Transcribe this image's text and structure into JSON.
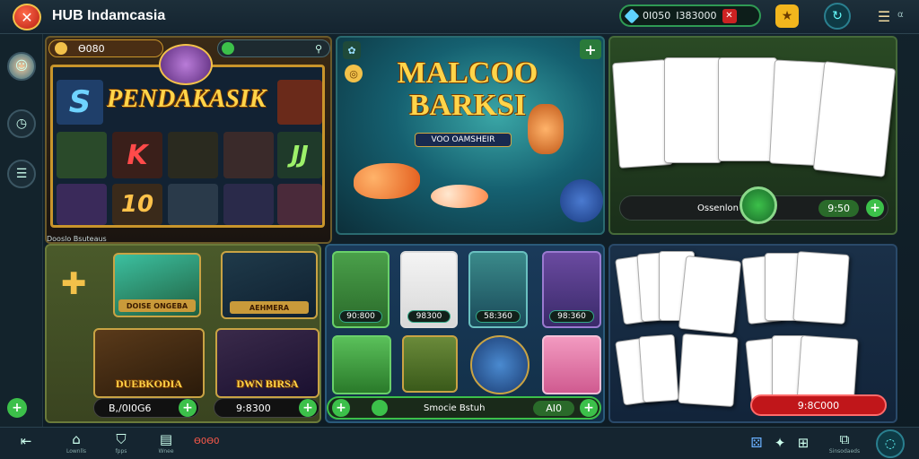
{
  "app": {
    "title": "HUB Indamcasia",
    "logo_glyph": "✕"
  },
  "topbar": {
    "wallet_a": "0I050",
    "wallet_b": "I383000",
    "icons": [
      "treasure-icon",
      "refresh-icon",
      "menu-icon"
    ],
    "corner_text": "α"
  },
  "sidebar": {
    "items": [
      "avatar",
      "history-icon",
      "list-icon"
    ]
  },
  "slot_panel": {
    "left_pill": "Ɵ080",
    "right_pill": "",
    "banner": "PENDAKASIK",
    "tiles": [
      "S",
      "K",
      "JJ",
      "10"
    ],
    "caption": "Dooslo Bsuteaus"
  },
  "fish_panel": {
    "title_line1": "MALCOO",
    "title_line2": "BARKSI",
    "badge": "VOO OAMSHEIR"
  },
  "cards_panel": {
    "label": "Ossenlon",
    "amount": "9:50"
  },
  "promo_panel": {
    "tiles": [
      {
        "label": "DOISE ONGEBA"
      },
      {
        "label": "AEHMERA"
      },
      {
        "label": "DUEBKODIA"
      },
      {
        "label": "DWN BIRSA"
      }
    ],
    "amount_left": "B,/0I0G6",
    "amount_right": "9:8300"
  },
  "fish_tiles_panel": {
    "prices": [
      "90:800",
      "98300",
      "58:360",
      "98:360"
    ],
    "bottom_label": "Smocie Bstuh",
    "bottom_amount": "AI0"
  },
  "card_games_panel": {
    "amount": "9:8C000"
  },
  "bottom_nav": {
    "items": [
      {
        "icon": "home-icon",
        "label": "Lownlls"
      },
      {
        "icon": "shield-icon",
        "label": "fpps"
      },
      {
        "icon": "bank-icon",
        "label": "Wnee"
      },
      {
        "icon": "coin-icon",
        "label": "Ɵ0Ɵ0"
      }
    ],
    "right_icons": [
      "dice-icon",
      "chip-icon",
      "grid-icon"
    ],
    "right_label": "Sinsodaeds"
  },
  "colors": {
    "accent": "#3cc04a",
    "brand": "#e2371f",
    "gold": "#f2c14a",
    "alert": "#c0161a"
  }
}
